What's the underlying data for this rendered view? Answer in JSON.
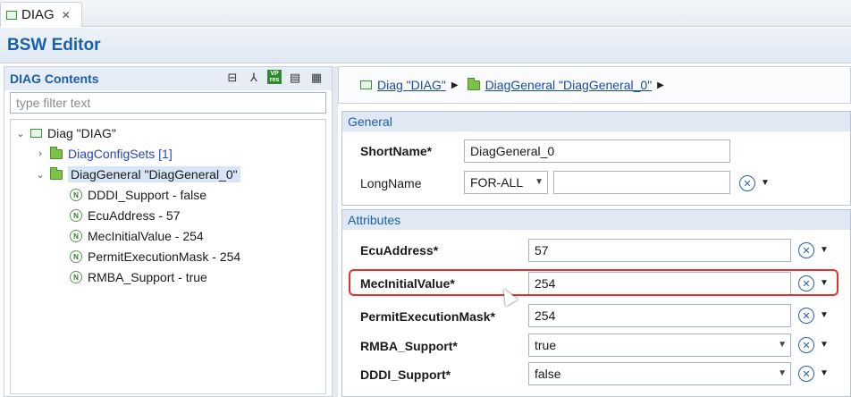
{
  "tab": {
    "label": "DIAG"
  },
  "editor": {
    "title": "BSW Editor"
  },
  "left": {
    "title": "DIAG Contents",
    "filter_placeholder": "type filter text",
    "tools": {
      "vp_top": "VP",
      "vp_bottom": "res"
    },
    "tree": {
      "root": "Diag \"DIAG\"",
      "config_sets": "DiagConfigSets [1]",
      "general": "DiagGeneral \"DiagGeneral_0\"",
      "params": [
        "DDDI_Support - false",
        "EcuAddress - 57",
        "MecInitialValue - 254",
        "PermitExecutionMask - 254",
        "RMBA_Support - true"
      ]
    }
  },
  "breadcrumb": {
    "first": "Diag \"DIAG\"",
    "second": "DiagGeneral \"DiagGeneral_0\""
  },
  "general": {
    "header": "General",
    "shortname_label": "ShortName*",
    "shortname_value": "DiagGeneral_0",
    "longname_label": "LongName",
    "longname_lang": "FOR-ALL",
    "longname_value": ""
  },
  "attributes": {
    "header": "Attributes",
    "ecu_label": "EcuAddress*",
    "ecu_value": "57",
    "mec_label": "MecInitialValue*",
    "mec_value": "254",
    "permit_label": "PermitExecutionMask*",
    "permit_value": "254",
    "rmba_label": "RMBA_Support*",
    "rmba_value": "true",
    "dddi_label": "DDDI_Support*",
    "dddi_value": "false"
  },
  "colors": {
    "accent": "#1a5fa8",
    "highlight": "#e53030"
  }
}
